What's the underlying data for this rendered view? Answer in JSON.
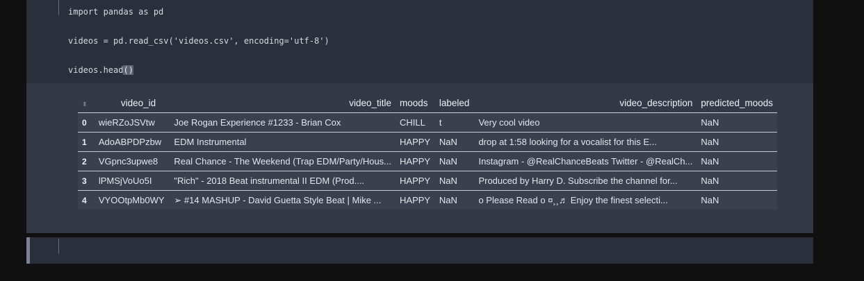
{
  "code_cell": {
    "line1": "import pandas as pd",
    "line2": "videos = pd.read_csv('videos.csv', encoding='utf-8')",
    "line3_prefix": "videos.head",
    "line3_paren": "()"
  },
  "dataframe": {
    "columns": [
      "video_id",
      "video_title",
      "moods",
      "labeled",
      "video_description",
      "predicted_moods"
    ],
    "rows": [
      {
        "index": "0",
        "video_id": "wieRZoJSVtw",
        "video_title": "Joe Rogan Experience #1233 - Brian Cox",
        "moods": "CHILL",
        "labeled": "t",
        "video_description": "Very cool video",
        "predicted_moods": "NaN"
      },
      {
        "index": "1",
        "video_id": "AdoABPDPzbw",
        "video_title": "EDM Instrumental",
        "moods": "HAPPY",
        "labeled": "NaN",
        "video_description": "drop at 1:58 looking for a vocalist for this E...",
        "predicted_moods": "NaN"
      },
      {
        "index": "2",
        "video_id": "VGpnc3upwe8",
        "video_title": "Real Chance - The Weekend (Trap EDM/Party/Hous...",
        "moods": "HAPPY",
        "labeled": "NaN",
        "video_description": "Instagram - @RealChanceBeats Twitter - @RealCh...",
        "predicted_moods": "NaN"
      },
      {
        "index": "3",
        "video_id": "lPMSjVoUo5I",
        "video_title": "\"Rich\" - 2018 Beat instrumental II EDM (Prod....",
        "moods": "HAPPY",
        "labeled": "NaN",
        "video_description": "Produced by Harry D. Subscribe the channel for...",
        "predicted_moods": "NaN"
      },
      {
        "index": "4",
        "video_id": "VYOOtpMb0WY",
        "video_title": "➢ #14 MASHUP - David Guetta Style Beat | Mike ...",
        "moods": "HAPPY",
        "labeled": "NaN",
        "video_description": "o Please Read o ¤¸¸♬ Enjoy the finest selecti...",
        "predicted_moods": "NaN"
      }
    ]
  },
  "colors": {
    "page_bg": "#101010",
    "input_cell_bg": "#2a2f3b",
    "output_cell_bg": "#333947",
    "row_bg": "#3a404e"
  },
  "icons": {
    "sort": "sort-indicator-icon"
  }
}
